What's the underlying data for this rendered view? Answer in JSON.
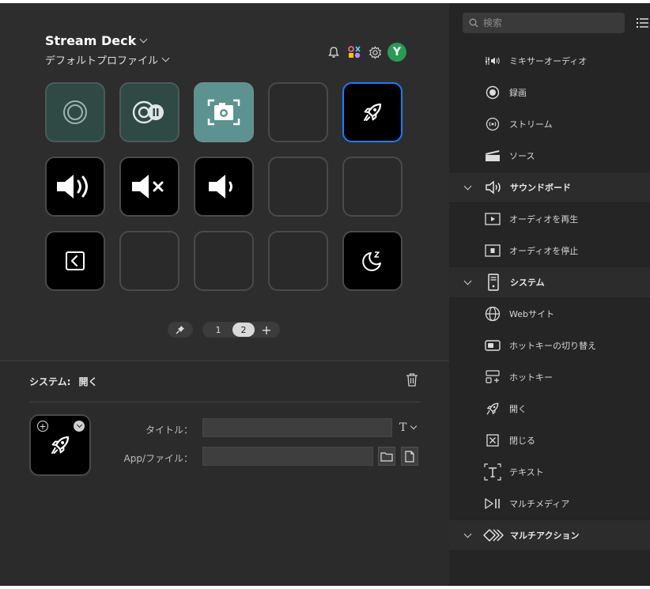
{
  "header": {
    "deck_name": "Stream Deck",
    "profile_name": "デフォルトプロファイル",
    "avatar_letter": "Y"
  },
  "keys": [
    {
      "icon": "obs-record-icon",
      "style": "dark-teal"
    },
    {
      "icon": "obs-record-pause-icon",
      "style": "dark-teal"
    },
    {
      "icon": "screenshot-camera-icon",
      "style": "teal"
    },
    {
      "icon": "empty",
      "style": "empty"
    },
    {
      "icon": "rocket-icon",
      "style": "selected"
    },
    {
      "icon": "volume-up-icon",
      "style": "black"
    },
    {
      "icon": "volume-mute-icon",
      "style": "black"
    },
    {
      "icon": "volume-down-icon",
      "style": "black"
    },
    {
      "icon": "empty",
      "style": "empty"
    },
    {
      "icon": "empty",
      "style": "empty"
    },
    {
      "icon": "back-icon",
      "style": "black"
    },
    {
      "icon": "empty",
      "style": "empty"
    },
    {
      "icon": "empty",
      "style": "empty"
    },
    {
      "icon": "empty",
      "style": "empty"
    },
    {
      "icon": "sleep-moon-icon",
      "style": "black"
    }
  ],
  "pager": {
    "pages": [
      "1",
      "2"
    ],
    "active_page": "2",
    "add_label": "+"
  },
  "inspector": {
    "category": "システム:",
    "action": "開く",
    "title_label": "タイトル：",
    "title_value": "",
    "file_label": "App/ファイル：",
    "file_value": "",
    "font_button": "T"
  },
  "sidebar": {
    "search_placeholder": "検索",
    "rows": [
      {
        "kind": "item",
        "label": "ミキサーオーディオ",
        "icon": "mixer-audio-icon"
      },
      {
        "kind": "item",
        "label": "録画",
        "icon": "record-icon"
      },
      {
        "kind": "item",
        "label": "ストリーム",
        "icon": "stream-icon"
      },
      {
        "kind": "item",
        "label": "ソース",
        "icon": "source-icon"
      },
      {
        "kind": "category",
        "label": "サウンドボード",
        "icon": "soundboard-icon"
      },
      {
        "kind": "item",
        "label": "オーディオを再生",
        "icon": "play-audio-icon"
      },
      {
        "kind": "item",
        "label": "オーディオを停止",
        "icon": "stop-audio-icon"
      },
      {
        "kind": "category",
        "label": "システム",
        "icon": "system-icon"
      },
      {
        "kind": "item",
        "label": "Webサイト",
        "icon": "globe-icon"
      },
      {
        "kind": "item",
        "label": "ホットキーの切り替え",
        "icon": "hotkey-switch-icon"
      },
      {
        "kind": "item",
        "label": "ホットキー",
        "icon": "hotkey-icon"
      },
      {
        "kind": "item",
        "label": "開く",
        "icon": "rocket-icon"
      },
      {
        "kind": "item",
        "label": "閉じる",
        "icon": "close-box-icon"
      },
      {
        "kind": "item",
        "label": "テキスト",
        "icon": "text-icon"
      },
      {
        "kind": "item",
        "label": "マルチメディア",
        "icon": "multimedia-icon"
      },
      {
        "kind": "category",
        "label": "マルチアクション",
        "icon": "multi-action-icon"
      }
    ]
  },
  "colors": {
    "accent": "#1e7bff",
    "avatar": "#2a9b54",
    "teal_key": "#5c9390"
  }
}
